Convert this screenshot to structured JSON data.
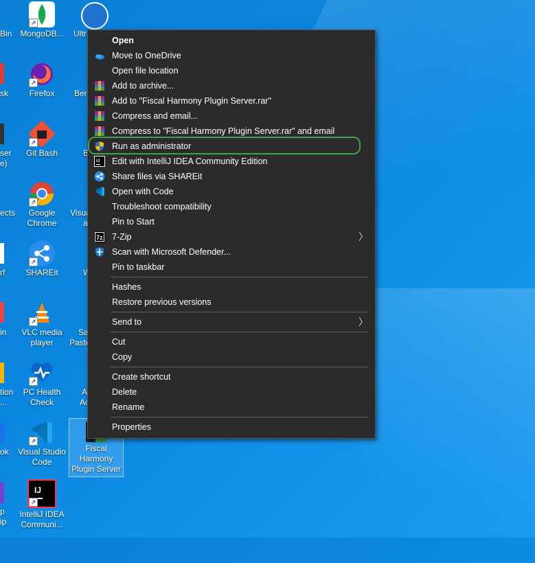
{
  "desktop": {
    "icons": [
      {
        "label": "MongoDB...",
        "color": "#ffffff",
        "accent": "#13aa52",
        "icon": "mongodb-leaf-icon"
      },
      {
        "label": "Firefox",
        "color": "#ff7139",
        "accent": "#6b1fb3",
        "icon": "firefox-icon"
      },
      {
        "label": "Git Bash",
        "color": "#1f1f1f",
        "accent": "#f05033",
        "icon": "git-bash-icon"
      },
      {
        "label": "Google Chrome",
        "color": "#ffffff",
        "accent": "#4285f4",
        "icon": "chrome-icon"
      },
      {
        "label": "SHAREit",
        "color": "#2b8cf0",
        "accent": "#ffffff",
        "icon": "shareit-icon"
      },
      {
        "label": "VLC media player",
        "color": "#ff8800",
        "accent": "#ffffff",
        "icon": "vlc-cone-icon"
      },
      {
        "label": "PC Health Check",
        "color": "#0a67c9",
        "accent": "#ffffff",
        "icon": "pc-health-icon"
      },
      {
        "label": "Visual Studio Code",
        "color": "#0065a9",
        "accent": "#23a9f2",
        "icon": "vscode-icon"
      },
      {
        "label": "IntelliJ IDEA Communi...",
        "color": "#000000",
        "accent": "#fe315d",
        "icon": "intellij-icon"
      },
      {
        "label": "Fiscal Harmony Plugin Server",
        "color": "#1e1e1e",
        "accent": "#3c9a3c",
        "icon": "app-icon"
      }
    ],
    "partial_left": [
      "Bin",
      "sk",
      "ser",
      "e)",
      "ects",
      "rf",
      "in",
      "tion",
      "...",
      "ok",
      "p",
      "ip"
    ],
    "partial_col3": [
      "Ultr",
      "Ber",
      "B",
      "Visua",
      "a",
      "W",
      "Sa",
      "Paste",
      "A",
      "Ac"
    ]
  },
  "context_menu": {
    "items": [
      {
        "label": "Open",
        "bold": true,
        "icon": ""
      },
      {
        "label": "Move to OneDrive",
        "icon": "onedrive-icon"
      },
      {
        "label": "Open file location",
        "icon": ""
      },
      {
        "label": "Add to archive...",
        "icon": "winrar-icon"
      },
      {
        "label": "Add to \"Fiscal Harmony Plugin Server.rar\"",
        "icon": "winrar-icon"
      },
      {
        "label": "Compress and email...",
        "icon": "winrar-icon"
      },
      {
        "label": "Compress to \"Fiscal Harmony Plugin Server.rar\" and email",
        "icon": "winrar-icon"
      },
      {
        "label": "Run as administrator",
        "icon": "uac-shield-icon"
      },
      {
        "label": "Edit with IntelliJ IDEA Community Edition",
        "icon": "intellij-icon"
      },
      {
        "label": "Share files via SHAREit",
        "icon": "shareit-icon"
      },
      {
        "label": "Open with Code",
        "icon": "vscode-icon"
      },
      {
        "label": "Troubleshoot compatibility",
        "icon": ""
      },
      {
        "label": "Pin to Start",
        "icon": ""
      },
      {
        "label": "7-Zip",
        "icon": "7zip-icon",
        "submenu": true
      },
      {
        "label": "Scan with Microsoft Defender...",
        "icon": "defender-icon"
      },
      {
        "label": "Pin to taskbar",
        "icon": ""
      },
      {
        "label": "Hashes",
        "icon": ""
      },
      {
        "label": "Restore previous versions",
        "icon": ""
      },
      {
        "label": "Send to",
        "icon": "",
        "submenu": true
      },
      {
        "label": "Cut",
        "icon": ""
      },
      {
        "label": "Copy",
        "icon": ""
      },
      {
        "label": "Create shortcut",
        "icon": ""
      },
      {
        "label": "Delete",
        "icon": ""
      },
      {
        "label": "Rename",
        "icon": ""
      },
      {
        "label": "Properties",
        "icon": ""
      }
    ],
    "submenu_glyph": "〉",
    "highlight_color": "#3fa34d"
  }
}
